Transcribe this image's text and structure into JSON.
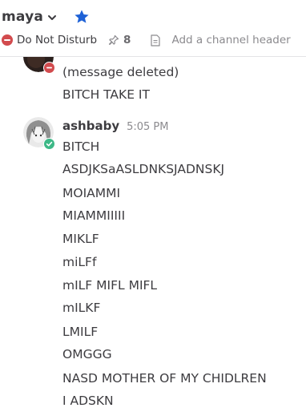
{
  "header": {
    "channel_name": "maya",
    "status_text": "Do Not Disturb",
    "pinned_count": "8",
    "add_header_text": "Add a channel header",
    "accent_color": "#1e61d6"
  },
  "posts": [
    {
      "messages": [
        "(message deleted)",
        "BITCH TAKE IT"
      ]
    },
    {
      "username": "ashbaby",
      "time": "5:05 PM",
      "messages": [
        "BITCH",
        "ASDJKSaASLDNKSJADNSKJ",
        "MOIAMMI",
        "MIAMMIIIII",
        "MIKLF",
        "miLFf",
        "mILF MIFL MIFL",
        "mILKF",
        "LMILF",
        "OMGGG",
        "NASD MOTHER OF MY CHIDLREN",
        "I ADSKN"
      ]
    }
  ]
}
